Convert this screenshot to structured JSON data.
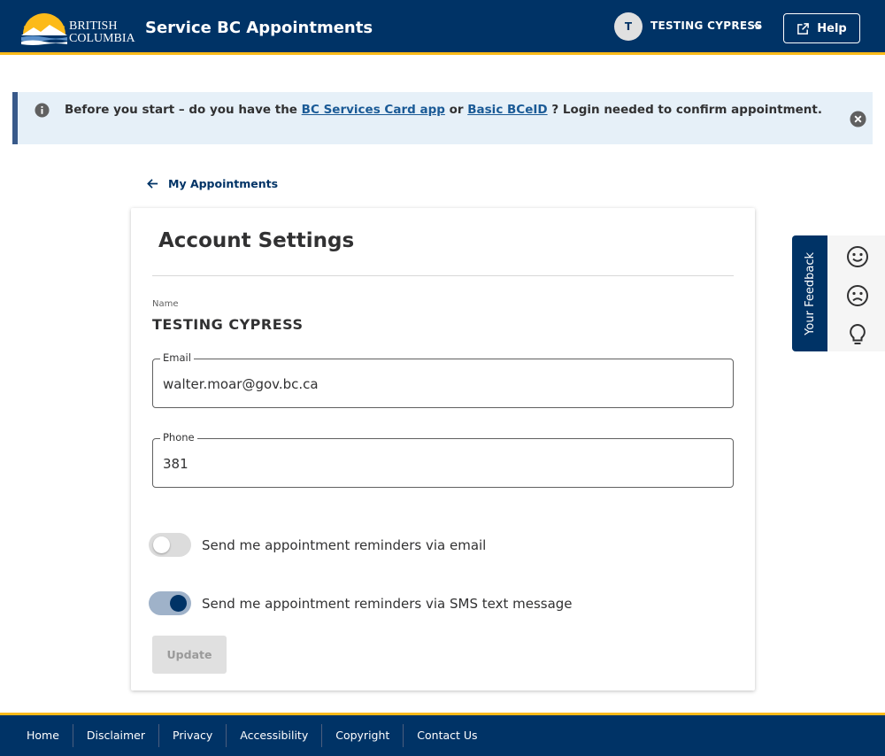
{
  "header": {
    "logo_line1": "BRITISH",
    "logo_line2": "COLUMBIA",
    "title": "Service BC Appointments",
    "user_initial": "T",
    "user_name": "TESTING CYPRESS",
    "help_label": "Help"
  },
  "banner": {
    "text_before": "Before you start – do you have the",
    "link1": "BC Services Card app",
    "text_or": "or",
    "link2": "Basic BCeID",
    "text_after": "? Login needed to confirm appointment."
  },
  "back_link": {
    "label": "My Appointments"
  },
  "account": {
    "title": "Account Settings",
    "name_label": "Name",
    "name_value": "TESTING CYPRESS",
    "email_label": "Email",
    "email_value": "walter.moar@gov.bc.ca",
    "phone_label": "Phone",
    "phone_value": "381",
    "email_toggle_label": "Send me appointment reminders via email",
    "email_toggle_on": false,
    "sms_toggle_label": "Send me appointment reminders via SMS text message",
    "sms_toggle_on": true,
    "update_label": "Update"
  },
  "feedback": {
    "tab_label": "Your Feedback",
    "icons": [
      "smile-icon",
      "frown-icon",
      "lightbulb-icon"
    ]
  },
  "footer": {
    "links": [
      "Home",
      "Disclaimer",
      "Privacy",
      "Accessibility",
      "Copyright",
      "Contact Us"
    ]
  },
  "colors": {
    "primary": "#003366",
    "accent": "#fcba19",
    "link": "#1a5a96",
    "banner_bg": "#e6f0f8"
  }
}
